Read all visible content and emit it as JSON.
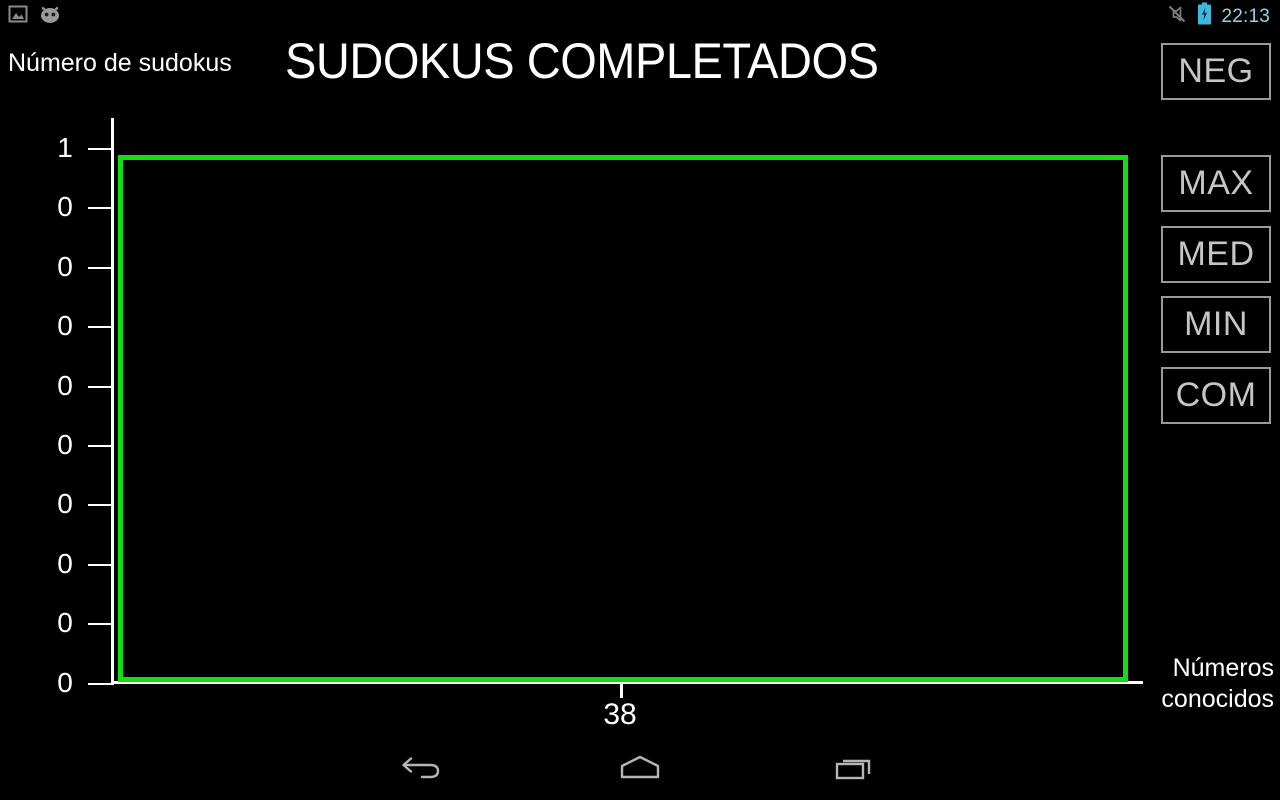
{
  "status_bar": {
    "icons_left": [
      "screenshot-icon",
      "android-face-icon"
    ],
    "icons_right": [
      "silent-mode-icon",
      "battery-charging-icon"
    ],
    "time": "22:13",
    "time_color": "#8fd4e8"
  },
  "header": {
    "title": "SUDOKUS COMPLETADOS",
    "y_axis_title": "Número de sudokus",
    "x_axis_title_line1": "Números",
    "x_axis_title_line2": "conocidos"
  },
  "buttons": [
    {
      "label": "NEG",
      "name": "neg-button"
    },
    {
      "label": "MAX",
      "name": "max-button"
    },
    {
      "label": "MED",
      "name": "med-button"
    },
    {
      "label": "MIN",
      "name": "min-button"
    },
    {
      "label": "COM",
      "name": "com-button"
    }
  ],
  "nav_bar": {
    "back": "back-icon",
    "home": "home-icon",
    "recents": "recents-icon"
  },
  "colors": {
    "plot_border": "#10e010",
    "axis": "#ffffff",
    "background": "#000000",
    "button_border": "#9a9a9a",
    "button_text": "#c6c6c6"
  },
  "chart_data": {
    "type": "bar",
    "title": "SUDOKUS COMPLETADOS",
    "xlabel": "Números conocidos",
    "ylabel": "Número de sudokus",
    "categories": [
      "38"
    ],
    "values": [
      0
    ],
    "x_ticks": [
      "38"
    ],
    "y_ticks": [
      "1",
      "0",
      "0",
      "0",
      "0",
      "0",
      "0",
      "0",
      "0",
      "0"
    ],
    "ylim": [
      0,
      1
    ],
    "grid": false,
    "legend": "none",
    "series": [
      {
        "name": "Sudokus completados",
        "values": [
          0
        ]
      }
    ],
    "note": "Plot area is empty — no bars drawn; only the green plot frame is visible."
  }
}
